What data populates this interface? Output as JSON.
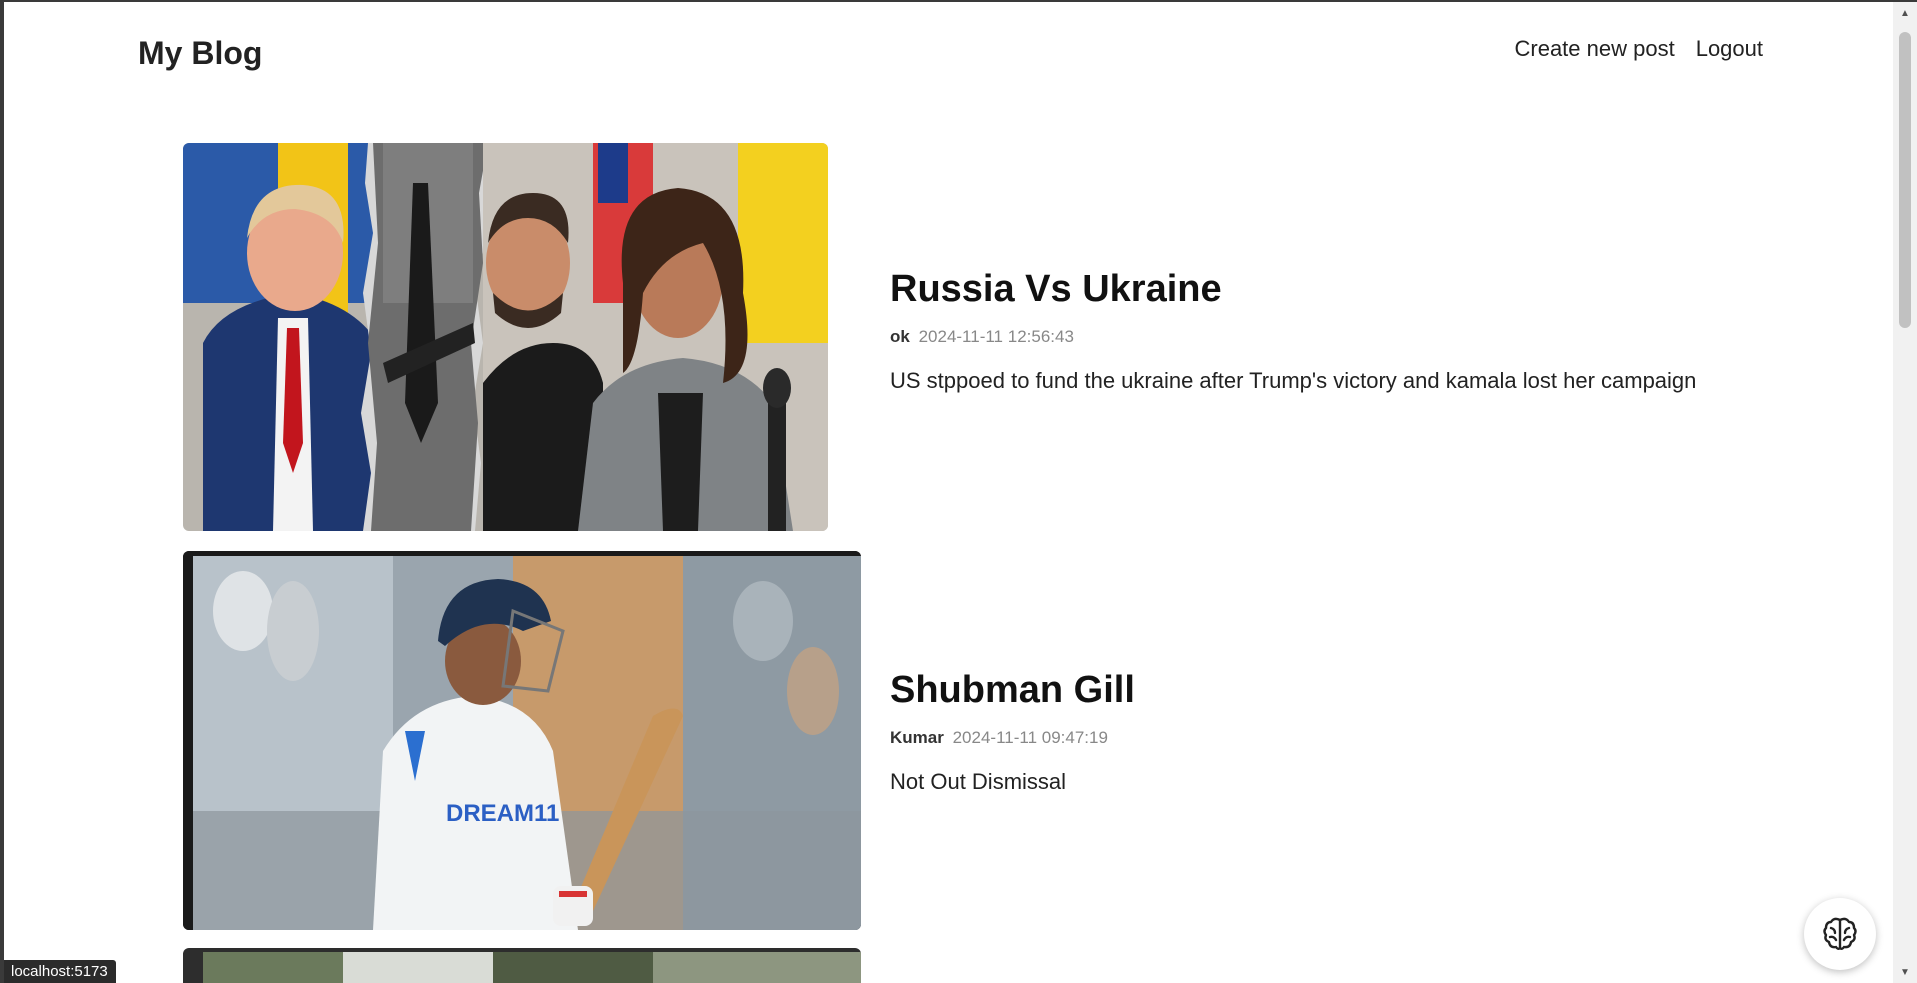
{
  "header": {
    "logo": "My Blog",
    "nav": {
      "create_label": "Create new post",
      "logout_label": "Logout"
    }
  },
  "posts": [
    {
      "title": "Russia Vs Ukraine",
      "author": "ok",
      "time": "2024-11-11 12:56:43",
      "summary": "US stppoed to fund the ukraine after Trump's victory and kamala lost her campaign"
    },
    {
      "title": "Shubman Gill",
      "author": "Kumar",
      "time": "2024-11-11 09:47:19",
      "summary": "Not Out Dismissal"
    }
  ],
  "status_bar": {
    "url": "localhost:5173"
  },
  "icons": {
    "fab": "brain-icon"
  }
}
